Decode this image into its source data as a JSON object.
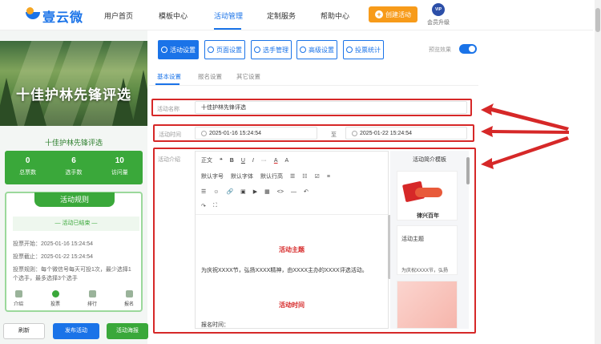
{
  "brand": "壹云微",
  "nav": {
    "items": [
      "用户首页",
      "模板中心",
      "活动管理",
      "定制服务",
      "帮助中心"
    ],
    "active": "活动管理",
    "create_button": "创建活动",
    "vip_badge": "VIP",
    "vip_label": "会员升级"
  },
  "preview": {
    "banner_title": "十佳护林先锋评选",
    "activity_name": "十佳护林先锋评选",
    "stats": [
      {
        "value": "0",
        "label": "总票数"
      },
      {
        "value": "6",
        "label": "选手数"
      },
      {
        "value": "10",
        "label": "访问量"
      }
    ],
    "rules_header": "活动规则",
    "ended_text": "— 活动已结束 —",
    "rules": [
      "投票开始：2025-01-16 15:24:54",
      "投票截止：2025-01-22 15:24:54",
      "投票规则：每个微信号每天可投1次，最少选择1个选手，最多选择3个选手"
    ],
    "tabs": [
      "介绍",
      "投票",
      "排行",
      "报名"
    ],
    "buttons": {
      "refresh": "刷新",
      "publish": "发布活动",
      "poster": "活动海报"
    }
  },
  "toolbar": {
    "buttons": [
      "活动设置",
      "页面设置",
      "选手管理",
      "高级设置",
      "投票统计"
    ],
    "preview_label": "预览效果"
  },
  "subtabs": [
    "基本设置",
    "报名设置",
    "其它设置"
  ],
  "form": {
    "name_label": "活动名称",
    "name_value": "十佳护林先锋评选",
    "time_label": "活动时间",
    "start_time": "2025-01-16 15:24:54",
    "to_label": "至",
    "end_time": "2025-01-22 15:24:54",
    "intro_label": "活动介绍"
  },
  "editor": {
    "toolbar_row1": [
      "正文",
      "❝",
      "B",
      "U",
      "I",
      "···",
      "A",
      "A"
    ],
    "toolbar_row2": [
      "默认字号",
      "默认字体",
      "默认行高",
      "☰",
      "☷",
      "☑",
      "≡"
    ],
    "toolbar_row3": [
      "☰",
      "☺",
      "🔗",
      "▣",
      "▶",
      "▦",
      "<>",
      "―",
      "↶"
    ],
    "toolbar_row4": [
      "↷",
      "⛶"
    ],
    "heading1": "活动主题",
    "paragraph1": "为庆祝XXXX节，弘扬XXXX精神，由XXXX主办的XXXX评选活动。",
    "heading2": "活动时间",
    "paragraph2": "报名时间："
  },
  "templates": {
    "title": "活动简介模板",
    "card1_caption": "律兴百年",
    "card2_heading": "活动主题",
    "card2_text": "为庆祝XXXX节，弘扬"
  }
}
